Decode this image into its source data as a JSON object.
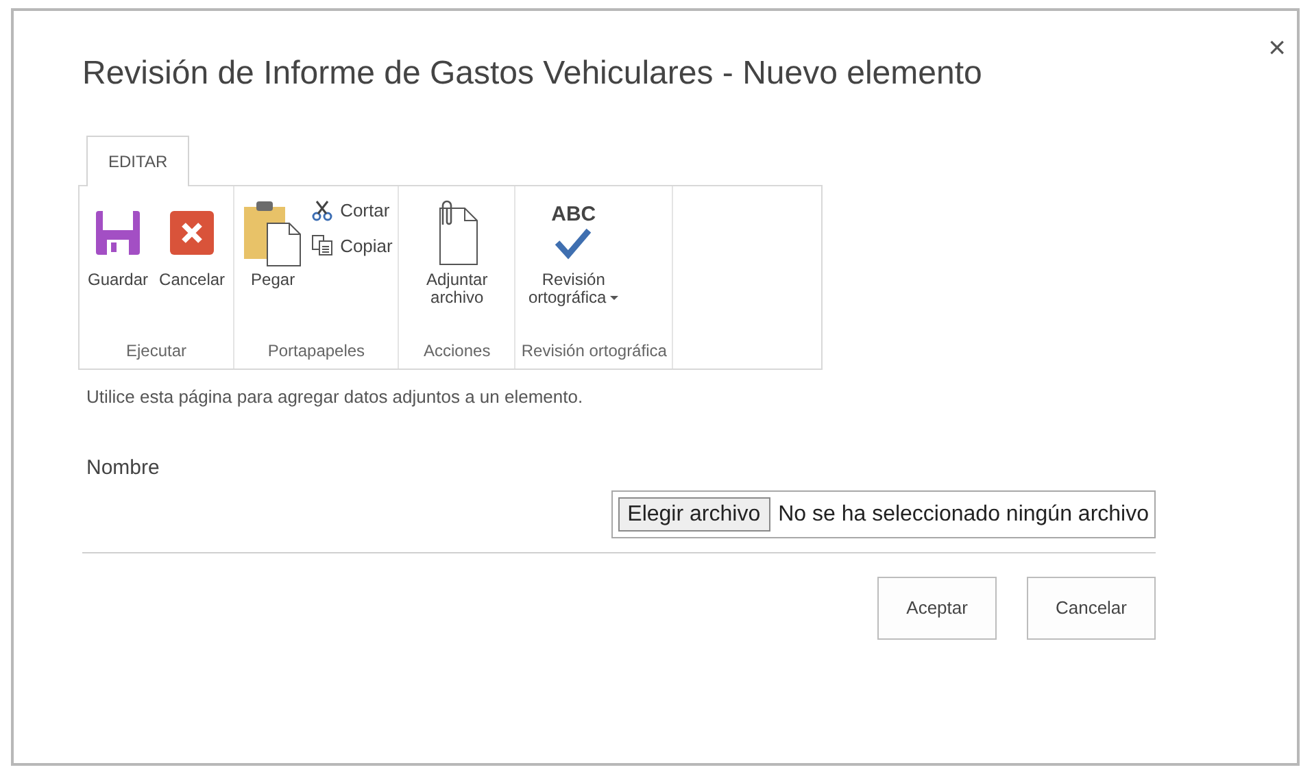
{
  "dialog": {
    "title": "Revisión de Informe de Gastos Vehiculares - Nuevo elemento",
    "close": "×"
  },
  "tabs": [
    {
      "label": "EDITAR",
      "selected": true
    }
  ],
  "ribbon": {
    "groups": [
      {
        "label": "Ejecutar",
        "buttons": [
          {
            "kind": "large",
            "label": "Guardar",
            "menu": false
          },
          {
            "kind": "large",
            "label": "Cancelar",
            "menu": false
          }
        ]
      },
      {
        "label": "Portapapeles",
        "buttons": [
          {
            "kind": "large",
            "label": "Pegar",
            "menu": false
          },
          {
            "kind": "small",
            "label": "Cortar",
            "menu": false
          },
          {
            "kind": "small",
            "label": "Copiar",
            "menu": false
          }
        ]
      },
      {
        "label": "Acciones",
        "buttons": [
          {
            "kind": "large",
            "label": "Adjuntar archivo",
            "menu": false
          }
        ]
      },
      {
        "label": "Revisión ortográfica",
        "buttons": [
          {
            "kind": "large",
            "label": "Revisión ortográfica",
            "menu": true,
            "icon_text": "ABC"
          }
        ]
      }
    ]
  },
  "instructions": "Utilice esta página para agregar datos adjuntos a un elemento.",
  "field": {
    "label": "Nombre",
    "button": "Elegir archivo",
    "status": "No se ha seleccionado ningún archivo"
  },
  "buttons": [
    "Aceptar",
    "Cancelar"
  ]
}
